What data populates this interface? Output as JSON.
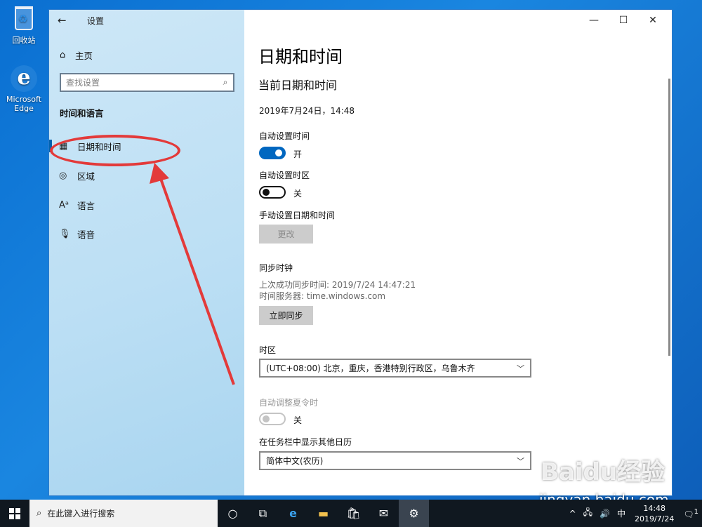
{
  "desktop": {
    "icons": [
      {
        "label": "回收站",
        "icon": "recycle-bin-icon"
      },
      {
        "label": "Microsoft Edge",
        "icon": "edge-icon"
      }
    ]
  },
  "window": {
    "app_title": "设置",
    "controls": {
      "minimize": "—",
      "maximize": "☐",
      "close": "✕"
    }
  },
  "sidebar": {
    "home_label": "主页",
    "search_placeholder": "查找设置",
    "section_title": "时间和语言",
    "items": [
      {
        "label": "日期和时间",
        "icon": "calendar-clock-icon",
        "active": true
      },
      {
        "label": "区域",
        "icon": "globe-icon",
        "active": false
      },
      {
        "label": "语言",
        "icon": "language-icon",
        "active": false
      },
      {
        "label": "语音",
        "icon": "microphone-icon",
        "active": false
      }
    ]
  },
  "main": {
    "page_title": "日期和时间",
    "subheading": "当前日期和时间",
    "current_datetime": "2019年7月24日，14:48",
    "auto_time": {
      "label": "自动设置时间",
      "state_text": "开",
      "on": true
    },
    "auto_timezone": {
      "label": "自动设置时区",
      "state_text": "关",
      "on": false
    },
    "manual": {
      "label": "手动设置日期和时间",
      "button": "更改"
    },
    "sync": {
      "title": "同步时钟",
      "last_sync": "上次成功同步时间: 2019/7/24 14:47:21",
      "server": "时间服务器: time.windows.com",
      "button": "立即同步"
    },
    "timezone": {
      "label": "时区",
      "value": "(UTC+08:00) 北京，重庆，香港特别行政区，乌鲁木齐"
    },
    "dst": {
      "label": "自动调整夏令时",
      "state_text": "关",
      "on": false,
      "disabled": true
    },
    "calendar": {
      "label": "在任务栏中显示其他日历",
      "value": "简体中文(农历)"
    }
  },
  "taskbar": {
    "search_placeholder": "在此键入进行搜索",
    "ime": "中",
    "time": "14:48",
    "date": "2019/7/24",
    "notification_count": "1"
  },
  "watermark": {
    "brand": "Baidu经验",
    "url": "jingyan.baidu.com"
  },
  "colors": {
    "accent": "#0067c0",
    "annotation": "#e33a3a"
  }
}
